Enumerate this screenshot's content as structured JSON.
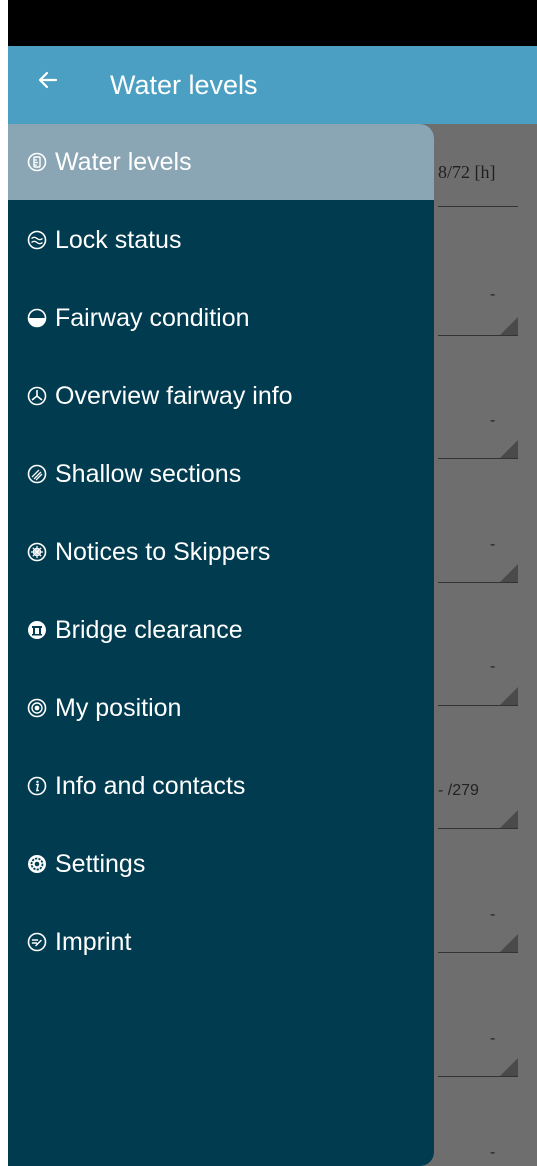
{
  "app_bar": {
    "title": "Water levels",
    "back_icon": "arrow-left-icon"
  },
  "background": {
    "header_text": "8/72 [h]",
    "row_values": [
      "-",
      "-",
      "-",
      "-",
      "- /279",
      "-",
      "-",
      "-"
    ]
  },
  "drawer": {
    "items": [
      {
        "label": "Water levels",
        "icon": "water-gauge-icon",
        "active": true
      },
      {
        "label": "Lock status",
        "icon": "lock-waves-icon",
        "active": false
      },
      {
        "label": "Fairway condition",
        "icon": "fairway-icon",
        "active": false
      },
      {
        "label": "Overview fairway info",
        "icon": "overview-icon",
        "active": false
      },
      {
        "label": "Shallow sections",
        "icon": "shallow-icon",
        "active": false
      },
      {
        "label": "Notices to Skippers",
        "icon": "ship-wheel-icon",
        "active": false
      },
      {
        "label": "Bridge clearance",
        "icon": "bridge-icon",
        "active": false
      },
      {
        "label": "My position",
        "icon": "position-icon",
        "active": false
      },
      {
        "label": "Info and contacts",
        "icon": "info-icon",
        "active": false
      },
      {
        "label": "Settings",
        "icon": "gear-icon",
        "active": false
      },
      {
        "label": "Imprint",
        "icon": "imprint-icon",
        "active": false
      }
    ]
  },
  "colors": {
    "app_bar": "#4a9fc2",
    "drawer": "#003b4f",
    "active_item": "#8aa5b3",
    "scrim": "#6e6e6e"
  }
}
